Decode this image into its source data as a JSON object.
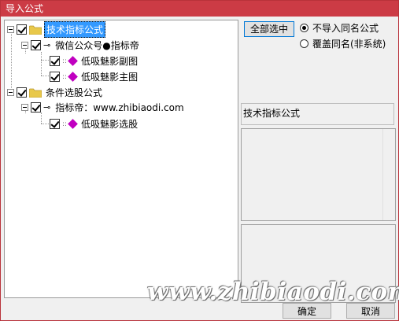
{
  "window": {
    "title": "导入公式"
  },
  "tree": {
    "root1": {
      "label": "技术指标公式",
      "checked": true,
      "selected": true
    },
    "group1": {
      "label": "微信公众号●指标帝",
      "checked": true
    },
    "item1": {
      "label": "低吸魅影副图",
      "checked": true
    },
    "item2": {
      "label": "低吸魅影主图",
      "checked": true
    },
    "root2": {
      "label": "条件选股公式",
      "checked": true
    },
    "group2": {
      "label": "指标帝：www.zhibiaodi.com",
      "checked": true
    },
    "item3": {
      "label": "低吸魅影选股",
      "checked": true
    }
  },
  "options": {
    "select_all": "全部选中",
    "radio1": {
      "label": "不导入同名公式",
      "selected": true
    },
    "radio2": {
      "label": "覆盖同名(非系统)",
      "selected": false
    }
  },
  "info_label": "技术指标公式",
  "buttons": {
    "ok": "确定",
    "cancel": "取消"
  },
  "watermark": "www.zhibiaodi.com",
  "colors": {
    "titlebar": "#cc3b45",
    "selection": "#3399ff",
    "formula_icon": "#c000c0",
    "folder": "#e8c84a"
  }
}
